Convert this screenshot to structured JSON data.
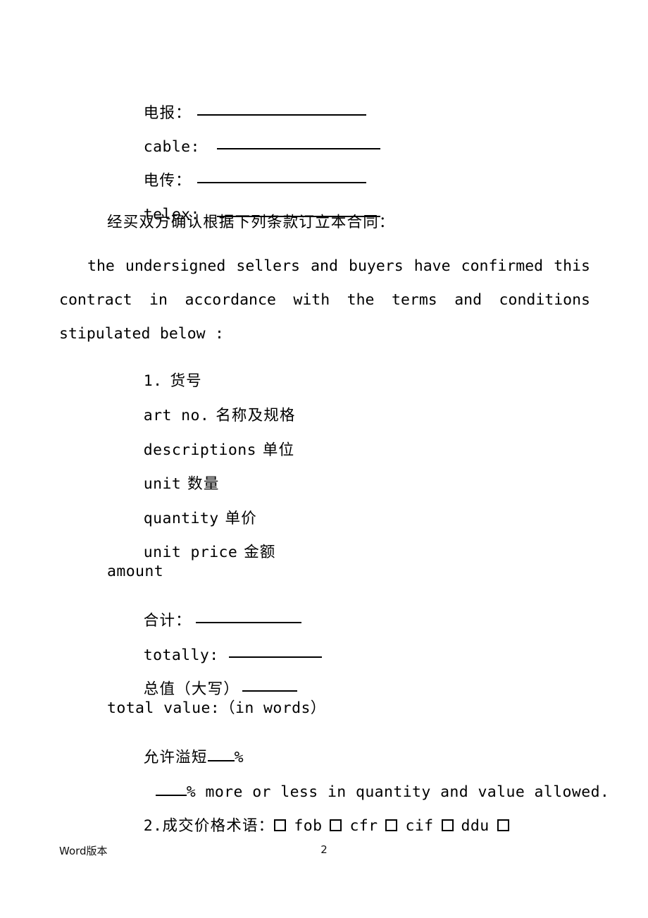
{
  "document": {
    "page_number": "2",
    "footer_label": "Word版本"
  },
  "contact_lines": [
    {
      "label": "电报：",
      "lang": "cn",
      "rule_width": 240,
      "gap": 8
    },
    {
      "label": "cable:",
      "lang": "en",
      "rule_width": 232,
      "gap": 24
    },
    {
      "label": "电传：",
      "lang": "cn",
      "rule_width": 240,
      "gap": 8
    },
    {
      "label": "telex:",
      "lang": "en",
      "rule_width": 232,
      "gap": 24
    }
  ],
  "intro": {
    "chinese": "经买双方确认根据下列条款订立本合同：",
    "english": "the undersigned sellers and buyers have confirmed this contract in accordance with the terms and conditions stipulated below :"
  },
  "clause1": {
    "number": "1.",
    "heading_cn": "货号",
    "rows": [
      {
        "en": "art no.",
        "cn": "名称及规格"
      },
      {
        "en": "descriptions",
        "cn": "单位"
      },
      {
        "en": "unit",
        "cn": "数量"
      },
      {
        "en": "quantity",
        "cn": "单价"
      },
      {
        "en": "unit price",
        "cn": "金额"
      },
      {
        "en": "amount",
        "cn": ""
      }
    ]
  },
  "totals": {
    "total_cn_label": "合计：",
    "total_cn_rule_width": 150,
    "total_en_label": "totally:",
    "total_en_rule_width": 132,
    "value_words_cn_label": "总值（大写）",
    "value_words_cn_rule_width": 78,
    "value_words_en_label": "total value:（in words）",
    "tolerance_cn_prefix": "允许溢短",
    "tolerance_cn_rule_width": 38,
    "tolerance_cn_suffix": "%",
    "tolerance_en_rule_width": 44,
    "tolerance_en_text": "% more or less in quantity and value allowed."
  },
  "clause2": {
    "number": "2.",
    "label_cn": "成交价格术语：",
    "terms": [
      "fob",
      "cfr",
      "cif",
      "ddu"
    ],
    "trailing_checkbox": true
  }
}
